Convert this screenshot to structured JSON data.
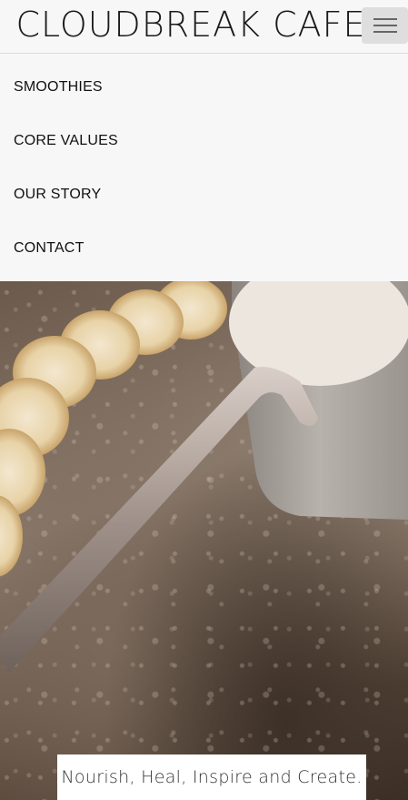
{
  "header": {
    "brand": "CLOUDBREAK CAFE",
    "menu_icon": "hamburger-icon"
  },
  "nav": {
    "items": [
      {
        "label": "SMOOTHIES"
      },
      {
        "label": "CORE VALUES"
      },
      {
        "label": "OUR STORY"
      },
      {
        "label": "CONTACT"
      }
    ]
  },
  "hero": {
    "tagline": "Nourish, Heal, Inspire and Create."
  }
}
